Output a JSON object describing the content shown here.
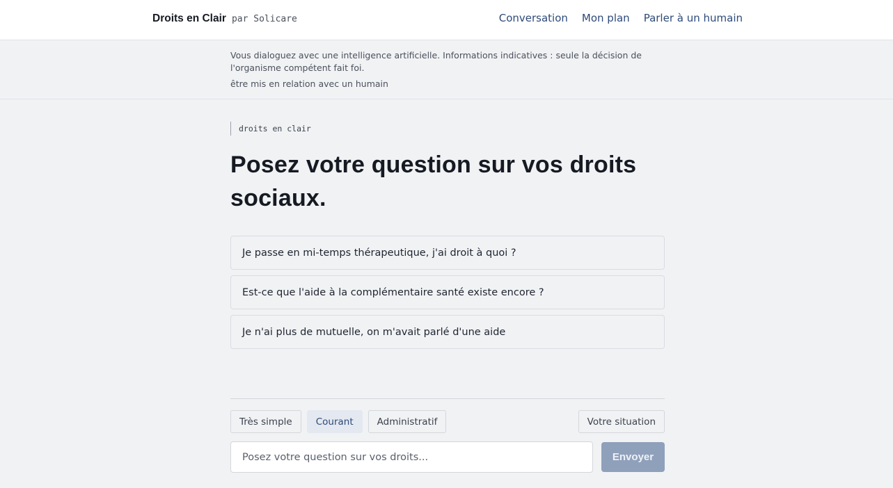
{
  "header": {
    "brand_name": "Droits en Clair",
    "brand_by": "par Solicare",
    "nav": [
      {
        "label": "Conversation"
      },
      {
        "label": "Mon plan"
      },
      {
        "label": "Parler à un humain"
      }
    ]
  },
  "disclaimer": {
    "text": "Vous dialoguez avec une intelligence artificielle. Informations indicatives : seule la décision de l'organisme compétent fait foi.",
    "link": "être mis en relation avec un humain"
  },
  "main": {
    "eyebrow": "droits en clair",
    "headline": "Posez votre question sur vos droits sociaux.",
    "suggestions": [
      {
        "text": "Je passe en mi-temps thérapeutique, j'ai droit à quoi ?"
      },
      {
        "text": "Est-ce que l'aide à la complémentaire santé existe encore ?"
      },
      {
        "text": "Je n'ai plus de mutuelle, on m'avait parlé d'une aide"
      }
    ]
  },
  "composer": {
    "levels": [
      {
        "label": "Très simple",
        "active": false
      },
      {
        "label": "Courant",
        "active": true
      },
      {
        "label": "Administratif",
        "active": false
      }
    ],
    "situation_label": "Votre situation",
    "input_placeholder": "Posez votre question sur vos droits...",
    "input_value": "",
    "send_label": "Envoyer"
  },
  "colors": {
    "accent": "#2d4a7a",
    "send_disabled": "#8fa0bb",
    "background": "#f1f2f4"
  }
}
